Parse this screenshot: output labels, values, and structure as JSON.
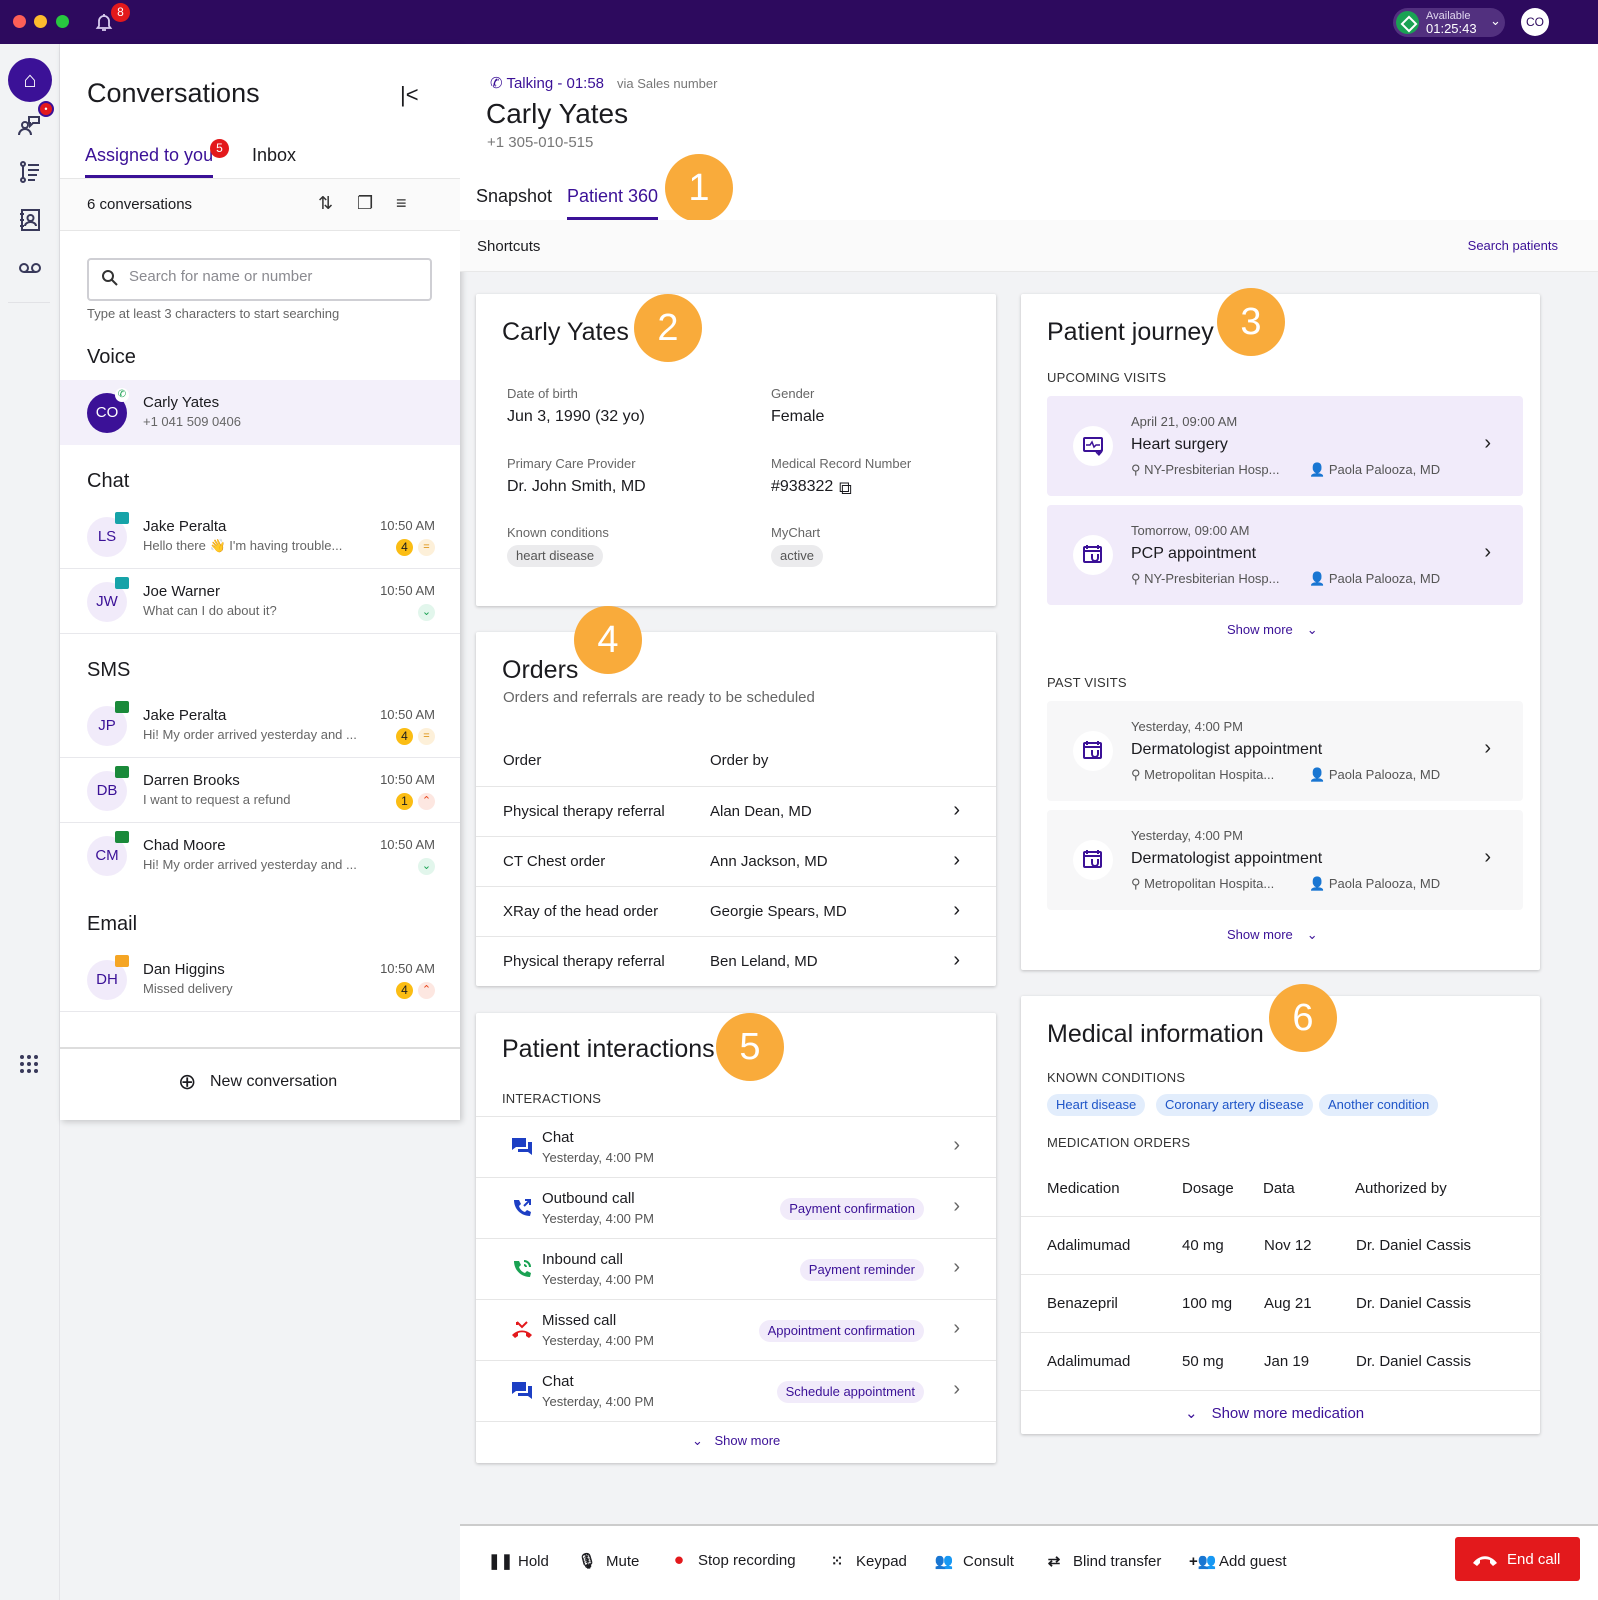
{
  "topbar": {
    "notifications_count": "8",
    "status_label": "Available",
    "status_timer": "01:25:43",
    "user_initials": "CO",
    "colors": {
      "bar": "#2d0a5e",
      "available": "#1aa253"
    }
  },
  "rail": {
    "items": [
      "home-icon",
      "conversations-icon",
      "tasks-icon",
      "contacts-icon",
      "voicemail-icon",
      "apps-icon"
    ]
  },
  "conversations": {
    "title": "Conversations",
    "tabs": [
      {
        "label": "Assigned to you",
        "badge": "5"
      },
      {
        "label": "Inbox"
      }
    ],
    "count_label": "6 conversations",
    "search_placeholder": "Search for name or number",
    "search_hint": "Type at least 3 characters to start searching",
    "voice": {
      "heading": "Voice",
      "items": [
        {
          "initials": "CO",
          "name": "Carly Yates",
          "sub": "+1 041 509 0406"
        }
      ]
    },
    "chat": {
      "heading": "Chat",
      "items": [
        {
          "initials": "LS",
          "name": "Jake Peralta",
          "sub": "Hello there 👋 I'm having trouble...",
          "time": "10:50 AM",
          "count": "4",
          "priority": "medium"
        },
        {
          "initials": "JW",
          "name": "Joe Warner",
          "sub": "What can I do about it?",
          "time": "10:50 AM",
          "count": "",
          "priority": "low"
        }
      ]
    },
    "sms": {
      "heading": "SMS",
      "items": [
        {
          "initials": "JP",
          "name": "Jake Peralta",
          "sub": "Hi! My order arrived yesterday and ...",
          "time": "10:50 AM",
          "count": "4",
          "priority": "medium"
        },
        {
          "initials": "DB",
          "name": "Darren Brooks",
          "sub": "I want to request a refund",
          "time": "10:50 AM",
          "count": "1",
          "priority": "high"
        },
        {
          "initials": "CM",
          "name": "Chad Moore",
          "sub": "Hi! My order arrived yesterday and ...",
          "time": "10:50 AM",
          "count": "",
          "priority": "low"
        }
      ]
    },
    "email": {
      "heading": "Email",
      "items": [
        {
          "initials": "DH",
          "name": "Dan Higgins",
          "sub": "Missed delivery",
          "time": "10:50 AM",
          "count": "4",
          "priority": "high"
        }
      ]
    },
    "new_conversation": "New conversation"
  },
  "call": {
    "status": "Talking - 01:58",
    "via": "via Sales number",
    "name": "Carly Yates",
    "phone": "+1 305-010-515",
    "tabs": [
      "Snapshot",
      "Patient 360"
    ],
    "active_tab": "Patient 360"
  },
  "annotations": [
    "1",
    "2",
    "3",
    "4",
    "5",
    "6"
  ],
  "shortcuts": {
    "label": "Shortcuts",
    "search_patients": "Search patients"
  },
  "patient": {
    "name": "Carly Yates",
    "fields": {
      "dob_label": "Date of birth",
      "dob": "Jun 3, 1990 (32 yo)",
      "gender_label": "Gender",
      "gender": "Female",
      "pcp_label": "Primary Care  Provider",
      "pcp": "Dr. John Smith, MD",
      "mrn_label": "Medical Record Number",
      "mrn": "#938322",
      "conditions_label": "Known conditions",
      "condition": "heart disease",
      "mychart_label": "MyChart",
      "mychart": "active"
    }
  },
  "journey": {
    "title": "Patient journey",
    "upcoming_label": "UPCOMING VISITS",
    "upcoming": [
      {
        "date": "April 21, 09:00 AM",
        "title": "Heart surgery",
        "location": "NY-Presbiterian Hosp...",
        "doctor": "Paola Palooza, MD",
        "icon": "heart-monitor-icon"
      },
      {
        "date": "Tomorrow, 09:00 AM",
        "title": "PCP appointment",
        "location": "NY-Presbiterian Hosp...",
        "doctor": "Paola Palooza, MD",
        "icon": "calendar-stethoscope-icon"
      }
    ],
    "past_label": "PAST VISITS",
    "past": [
      {
        "date": "Yesterday, 4:00 PM",
        "title": "Dermatologist appointment",
        "location": "Metropolitan Hospita...",
        "doctor": "Paola Palooza, MD",
        "icon": "calendar-stethoscope-icon"
      },
      {
        "date": "Yesterday, 4:00 PM",
        "title": "Dermatologist appointment",
        "location": "Metropolitan Hospita...",
        "doctor": "Paola Palooza, MD",
        "icon": "calendar-stethoscope-icon"
      }
    ],
    "show_more": "Show more"
  },
  "orders": {
    "title": "Orders",
    "subtitle": "Orders and referrals are ready to be scheduled",
    "columns": [
      "Order",
      "Order by"
    ],
    "rows": [
      [
        "Physical therapy referral",
        "Alan Dean, MD"
      ],
      [
        "CT Chest order",
        "Ann Jackson, MD"
      ],
      [
        "XRay of the head order",
        "Georgie Spears, MD"
      ],
      [
        "Physical therapy referral",
        "Ben Leland, MD"
      ]
    ]
  },
  "interactions": {
    "title": "Patient interactions",
    "caption": "INTERACTIONS",
    "rows": [
      {
        "type": "Chat",
        "time": "Yesterday, 4:00 PM",
        "tag": "",
        "icon": "chat-icon"
      },
      {
        "type": "Outbound call",
        "time": "Yesterday, 4:00 PM",
        "tag": "Payment confirmation",
        "icon": "outbound-call-icon"
      },
      {
        "type": "Inbound call",
        "time": "Yesterday, 4:00 PM",
        "tag": "Payment reminder",
        "icon": "inbound-call-icon"
      },
      {
        "type": "Missed call",
        "time": "Yesterday, 4:00 PM",
        "tag": "Appointment confirmation",
        "icon": "missed-call-icon"
      },
      {
        "type": "Chat",
        "time": "Yesterday, 4:00 PM",
        "tag": "Schedule appointment",
        "icon": "chat-icon"
      }
    ],
    "show_more": "Show more"
  },
  "medical": {
    "title": "Medical information",
    "conditions_label": "KNOWN CONDITIONS",
    "conditions": [
      "Heart disease",
      "Coronary artery disease",
      "Another condition"
    ],
    "orders_label": "MEDICATION ORDERS",
    "columns": [
      "Medication",
      "Dosage",
      "Data",
      "Authorized by"
    ],
    "rows": [
      [
        "Adalimumad",
        "40 mg",
        "Nov 12",
        "Dr. Daniel Cassis"
      ],
      [
        "Benazepril",
        "100 mg",
        "Aug 21",
        "Dr. Daniel Cassis"
      ],
      [
        "Adalimumad",
        "50 mg",
        "Jan 19",
        "Dr. Daniel Cassis"
      ]
    ],
    "show_more": "Show more medication"
  },
  "call_controls": {
    "hold": "Hold",
    "mute": "Mute",
    "stop_recording": "Stop recording",
    "keypad": "Keypad",
    "consult": "Consult",
    "blind_transfer": "Blind transfer",
    "add_guest": "Add guest",
    "end_call": "End call",
    "end_color": "#e3191c"
  }
}
